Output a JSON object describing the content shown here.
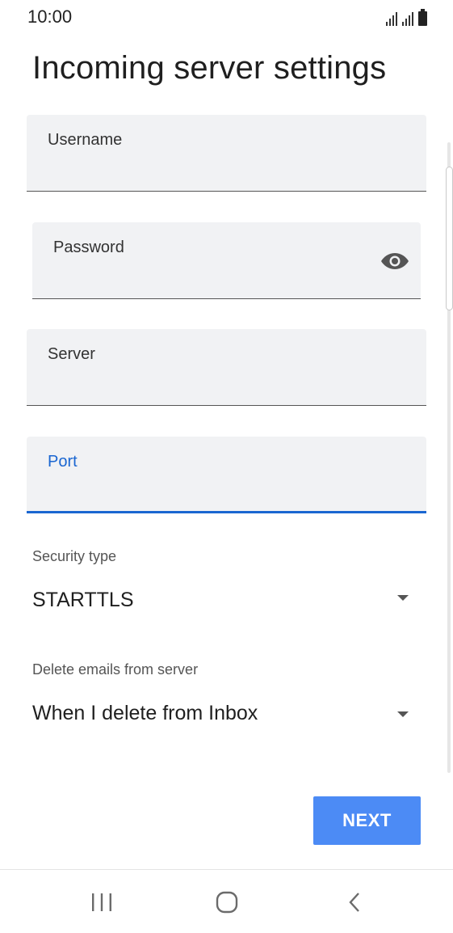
{
  "status_bar": {
    "time": "10:00",
    "icons": [
      "signal-icon",
      "signal-icon",
      "battery-icon"
    ]
  },
  "page": {
    "title": "Incoming server settings"
  },
  "fields": {
    "username": {
      "label": "Username",
      "value": ""
    },
    "password": {
      "label": "Password",
      "value": "",
      "toggle_icon": "eye-icon"
    },
    "server": {
      "label": "Server",
      "value": ""
    },
    "port": {
      "label": "Port",
      "value": "",
      "focused": true
    }
  },
  "security_type": {
    "caption": "Security type",
    "selected": "STARTTLS"
  },
  "delete_emails": {
    "caption": "Delete emails from server",
    "selected": "When I delete from Inbox"
  },
  "actions": {
    "next_label": "NEXT"
  },
  "colors": {
    "accent": "#1a66d1",
    "button": "#4c8bf5",
    "field_bg": "#f1f2f4"
  },
  "nav_bar": {
    "icons": [
      "recent-apps-icon",
      "home-icon",
      "back-icon"
    ]
  }
}
